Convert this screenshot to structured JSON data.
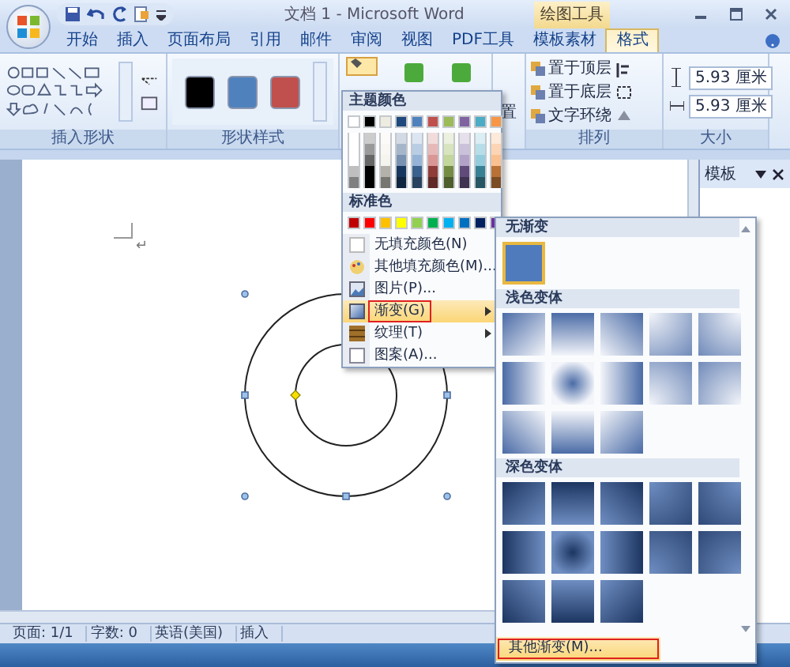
{
  "title_bar": {
    "title": "文档 1 - Microsoft Word",
    "context_tab": "绘图工具"
  },
  "tabs": [
    {
      "label": "开始",
      "selected": false
    },
    {
      "label": "插入",
      "selected": false
    },
    {
      "label": "页面布局",
      "selected": false
    },
    {
      "label": "引用",
      "selected": false
    },
    {
      "label": "邮件",
      "selected": false
    },
    {
      "label": "审阅",
      "selected": false
    },
    {
      "label": "视图",
      "selected": false
    },
    {
      "label": "PDF工具",
      "selected": false
    },
    {
      "label": "模板素材",
      "selected": false
    },
    {
      "label": "格式",
      "selected": true
    }
  ],
  "ribbon": {
    "insert_shapes": {
      "label": "插入形状"
    },
    "shape_styles": {
      "label": "形状样式",
      "swatches": [
        {
          "color": "#000000"
        },
        {
          "color": "#4f81bd"
        },
        {
          "color": "#c0504d"
        }
      ]
    },
    "position": {
      "label": "置"
    },
    "arrange": {
      "label": "排列",
      "buttons": [
        {
          "label": "置于顶层"
        },
        {
          "label": "置于底层"
        },
        {
          "label": "文字环绕"
        }
      ]
    },
    "size": {
      "label": "大小",
      "height": "5.93 厘米",
      "width": "5.93 厘米"
    }
  },
  "fill_menu": {
    "theme_header": "主题颜色",
    "theme_colors": [
      {
        "color": "#ffffff"
      },
      {
        "color": "#000000"
      },
      {
        "color": "#eeece1"
      },
      {
        "color": "#1f497d"
      },
      {
        "color": "#4f81bd"
      },
      {
        "color": "#c0504d"
      },
      {
        "color": "#9bbb59"
      },
      {
        "color": "#8064a2"
      },
      {
        "color": "#4bacc6"
      },
      {
        "color": "#f79646"
      }
    ],
    "standard_header": "标准色",
    "standard_colors": [
      {
        "color": "#c00000"
      },
      {
        "color": "#ff0000"
      },
      {
        "color": "#ffc000"
      },
      {
        "color": "#ffff00"
      },
      {
        "color": "#92d050"
      },
      {
        "color": "#00b050"
      },
      {
        "color": "#00b0f0"
      },
      {
        "color": "#0070c0"
      },
      {
        "color": "#002060"
      },
      {
        "color": "#7030a0"
      }
    ],
    "items": [
      {
        "label": "无填充颜色(N)",
        "kind": "none",
        "selected": false,
        "submenu": false,
        "annotated": false
      },
      {
        "label": "其他填充颜色(M)...",
        "kind": "color",
        "selected": false,
        "submenu": false,
        "annotated": false
      },
      {
        "label": "图片(P)...",
        "kind": "picture",
        "selected": false,
        "submenu": false,
        "annotated": false
      },
      {
        "label": "渐变(G)",
        "kind": "gradient",
        "selected": true,
        "submenu": true,
        "annotated": true
      },
      {
        "label": "纹理(T)",
        "kind": "texture",
        "selected": false,
        "submenu": true,
        "annotated": false
      },
      {
        "label": "图案(A)...",
        "kind": "pattern",
        "selected": false,
        "submenu": false,
        "annotated": false
      }
    ]
  },
  "gradient_menu": {
    "sections": [
      {
        "title": "无渐变",
        "kind": "solid",
        "swatches": [
          {
            "kind": "solid",
            "selected": true
          }
        ]
      },
      {
        "title": "浅色变体",
        "kind": "light",
        "swatches": [
          {
            "kind": "tl",
            "selected": false
          },
          {
            "kind": "t",
            "selected": false
          },
          {
            "kind": "tr",
            "selected": false
          },
          {
            "kind": "radial-tl",
            "selected": false
          },
          {
            "kind": "radial-tr",
            "selected": false
          },
          {
            "kind": "l",
            "selected": false
          },
          {
            "kind": "center",
            "selected": false
          },
          {
            "kind": "r",
            "selected": false
          },
          {
            "kind": "radial-bl",
            "selected": false
          },
          {
            "kind": "radial-br",
            "selected": false
          },
          {
            "kind": "bl",
            "selected": false
          },
          {
            "kind": "b",
            "selected": false
          },
          {
            "kind": "br",
            "selected": false
          }
        ]
      },
      {
        "title": "深色变体",
        "kind": "dark",
        "swatches": [
          {
            "kind": "tl",
            "selected": false
          },
          {
            "kind": "t",
            "selected": false
          },
          {
            "kind": "tr",
            "selected": false
          },
          {
            "kind": "radial-tl",
            "selected": false
          },
          {
            "kind": "radial-tr",
            "selected": false
          },
          {
            "kind": "l",
            "selected": false
          },
          {
            "kind": "center",
            "selected": false
          },
          {
            "kind": "r",
            "selected": false
          },
          {
            "kind": "radial-bl",
            "selected": false
          },
          {
            "kind": "radial-br",
            "selected": false
          },
          {
            "kind": "bl",
            "selected": false
          },
          {
            "kind": "b",
            "selected": false
          },
          {
            "kind": "br",
            "selected": false
          }
        ]
      }
    ],
    "more": {
      "label": "其他渐变(M)...",
      "annotated": true
    }
  },
  "document": {
    "paragraph_mark": "↵"
  },
  "task_pane": {
    "title": "模板"
  },
  "status_bar": {
    "items": [
      "页面: 1/1",
      "字数: 0",
      "英语(美国)",
      "插入"
    ]
  }
}
